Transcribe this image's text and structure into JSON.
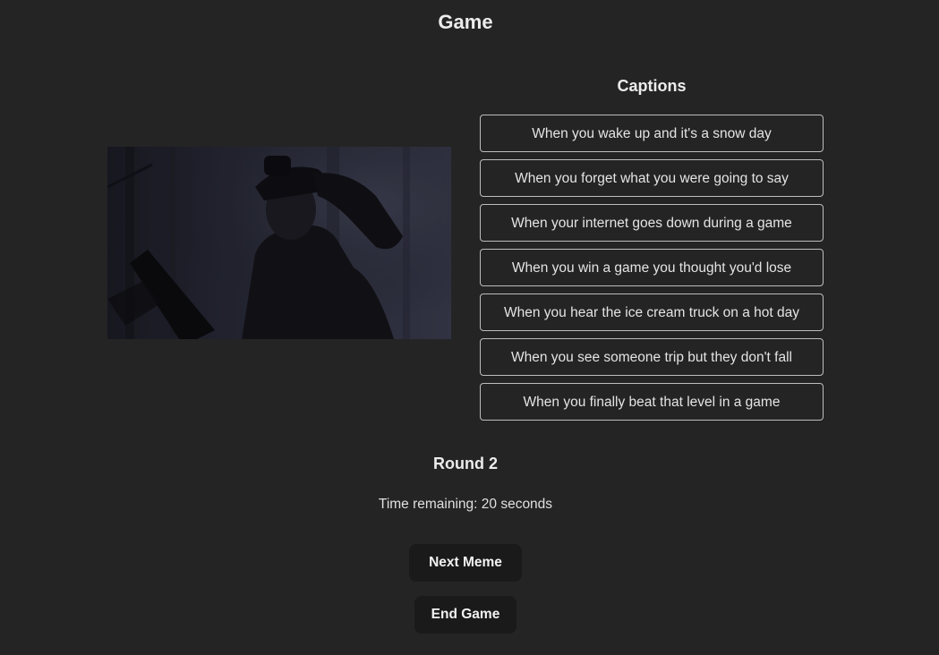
{
  "page": {
    "title": "Game"
  },
  "meme": {
    "image_description_icon": "meme-photo"
  },
  "captions": {
    "heading": "Captions",
    "items": [
      "When you wake up and it's a snow day",
      "When you forget what you were going to say",
      "When your internet goes down during a game",
      "When you win a game you thought you'd lose",
      "When you hear the ice cream truck on a hot day",
      "When you see someone trip but they don't fall",
      "When you finally beat that level in a game"
    ]
  },
  "round": {
    "label": "Round 2"
  },
  "timer": {
    "text": "Time remaining: 20 seconds"
  },
  "actions": {
    "next_label": "Next Meme",
    "end_label": "End Game"
  },
  "colors": {
    "background": "#242424",
    "button_dark": "#1a1a1a",
    "caption_border": "#bdbdbd"
  }
}
